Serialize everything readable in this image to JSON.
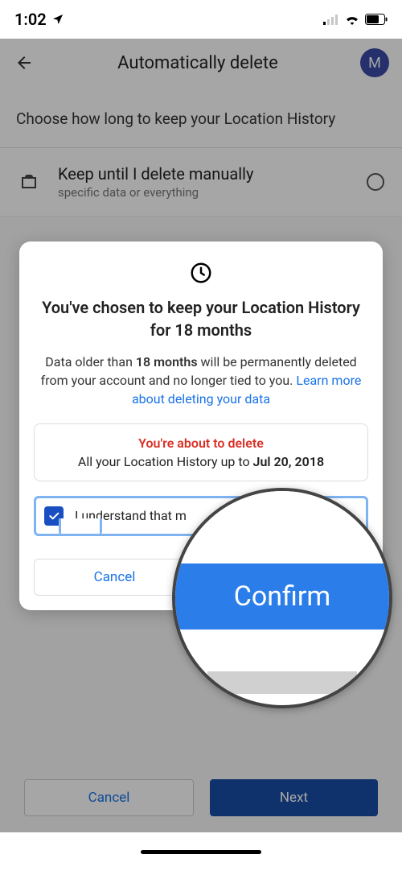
{
  "statusbar": {
    "time": "1:02"
  },
  "header": {
    "title": "Automatically delete",
    "avatar": "M"
  },
  "subhead": "Choose how long to keep your Location History",
  "option": {
    "title": "Keep until I delete manually",
    "sub": "specific data or everything"
  },
  "footer": {
    "cancel": "Cancel",
    "next": "Next"
  },
  "modal": {
    "title": "You've chosen to keep your Location History for 18 months",
    "body_prefix": "Data older than ",
    "body_months": "18 months",
    "body_middle": " will be permanently deleted from your account and no longer tied to you. ",
    "body_link": "Learn more about deleting your data",
    "warn_top": "You're about to delete",
    "warn_line_prefix": "All your Location History up to ",
    "warn_date": "Jul 20, 2018",
    "consent": "I understand that m",
    "cancel": "Cancel",
    "confirm": "Confirm"
  },
  "magnifier": {
    "confirm": "Confirm"
  }
}
